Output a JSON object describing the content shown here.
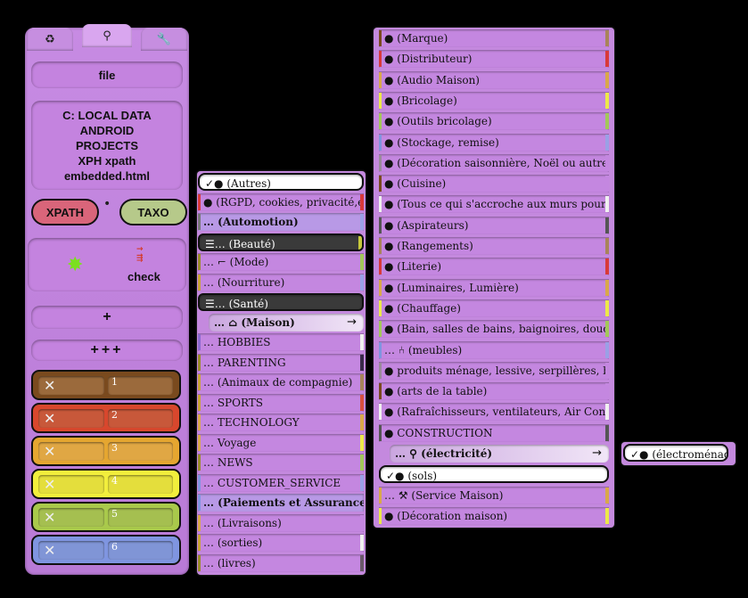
{
  "left": {
    "tabs": [
      {
        "icon": "recycle-icon",
        "glyph": "♻"
      },
      {
        "icon": "search-icon",
        "glyph": "⚲"
      },
      {
        "icon": "wrench-icon",
        "glyph": "🔧"
      }
    ],
    "file_label": "file",
    "path_lines": [
      "C: LOCAL DATA",
      "ANDROID",
      "PROJECTS",
      "XPH xpath",
      "embedded.html"
    ],
    "xpath_label": "XPATH",
    "dot": "•",
    "taxo_label": "TAXO",
    "check_label": "check",
    "plus_label": "+",
    "plus3_label": "+++",
    "colors": [
      {
        "bg": "#7a4a1e",
        "chip": "#9b6a3c",
        "num": "1"
      },
      {
        "bg": "#d8472d",
        "chip": "#c8583a",
        "num": "2"
      },
      {
        "bg": "#e5a630",
        "chip": "#e0a744",
        "num": "3"
      },
      {
        "bg": "#f2ee3c",
        "chip": "#e4de3c",
        "num": "4"
      },
      {
        "bg": "#a9c94b",
        "chip": "#a5bf50",
        "num": "5"
      },
      {
        "bg": "#7f95e0",
        "chip": "#8095d6",
        "num": "6"
      }
    ]
  },
  "list1": [
    {
      "text": "✓● (Autres)",
      "style": "white"
    },
    {
      "text": "● (RGPD, cookies, privacité,etc)",
      "lb": "#d83a3a",
      "rb": "#d83a3a"
    },
    {
      "text": "… (Automotion)",
      "lb": "#777",
      "rb": "#9aa0e6",
      "bold": true,
      "bg": "#b899e6"
    },
    {
      "text": "☰… (Beauté)",
      "style": "dark",
      "rb": "#c7c83c"
    },
    {
      "text": "… ⌐ (Mode)",
      "lb": "#9a8b2a",
      "rb": "#a3c75a"
    },
    {
      "text": "… (Nourriture)",
      "lb": "#c7a335",
      "rb": "#9aa0e6"
    },
    {
      "text": "☰… (Santé)",
      "style": "dark"
    },
    {
      "text": "… ⌂ (Maison)",
      "style": "light",
      "arrow": "→",
      "bold": true,
      "indent": true
    },
    {
      "text": "… HOBBIES",
      "lb": "#8a6ad0",
      "rb": "#f0f0f0"
    },
    {
      "text": "… PARENTING",
      "lb": "#9a8b2a",
      "rb": "#3a2a4a"
    },
    {
      "text": "… (Animaux de compagnie)",
      "lb": "#c7a335",
      "rb": "#a8845a"
    },
    {
      "text": "… SPORTS",
      "lb": "#c7a335",
      "rb": "#d85040"
    },
    {
      "text": "… TECHNOLOGY",
      "lb": "#d8a84a",
      "rb": "#d8a84a"
    },
    {
      "text": "… Voyage",
      "lb": "#d8a84a",
      "rb": "#ece84a"
    },
    {
      "text": "… NEWS",
      "lb": "#9a8b2a",
      "rb": "#a3c75a"
    },
    {
      "text": "… CUSTOMER_SERVICE",
      "lb": "#7f95e0",
      "rb": "#9aa0e6"
    },
    {
      "text": "… (Paiements et Assurances)",
      "lb": "#7f95e0",
      "bold": true,
      "bg": "#b899e6"
    },
    {
      "text": "… (Livraisons)",
      "lb": "#d8a84a",
      "rb": "#c487e0"
    },
    {
      "text": "… (sorties)",
      "lb": "#c7a335",
      "rb": "#f0f0f0"
    },
    {
      "text": "… (livres)",
      "lb": "#9a8b2a",
      "rb": "#6a5a6a"
    }
  ],
  "list2": [
    {
      "text": "● (Marque)",
      "lb": "#7a4a1e",
      "rb": "#a8845a"
    },
    {
      "text": "● (Distributeur)",
      "lb": "#d83a3a",
      "rb": "#d83a3a"
    },
    {
      "text": "● (Audio Maison)",
      "lb": "#d8a84a",
      "rb": "#d8a84a"
    },
    {
      "text": "● (Bricolage)",
      "lb": "#ece84a",
      "rb": "#ece84a"
    },
    {
      "text": "● (Outils bricolage)",
      "lb": "#a3c75a",
      "rb": "#a3c75a"
    },
    {
      "text": "● (Stockage, remise)",
      "lb": "#7f95e0",
      "rb": "#9aa0e6"
    },
    {
      "text": "● (Décoration saisonnière, Noël ou autres fêtes)",
      "lb": "#9a8b9a",
      "rb": "#c487e0"
    },
    {
      "text": "● (Cuisine)",
      "lb": "#7a4a1e",
      "rb": "#c487e0"
    },
    {
      "text": "● (Tous ce qui s'accroche aux murs pour décorer)",
      "lb": "#f0f0f0",
      "rb": "#f0f0f0"
    },
    {
      "text": "● (Aspirateurs)",
      "lb": "#555",
      "rb": "#555"
    },
    {
      "text": "● (Rangements)",
      "lb": "#a8845a",
      "rb": "#a8845a"
    },
    {
      "text": "● (Literie)",
      "lb": "#d83a3a",
      "rb": "#d83a3a"
    },
    {
      "text": "● (Luminaires, Lumière)",
      "lb": "#d8a84a",
      "rb": "#d8a84a"
    },
    {
      "text": "● (Chauffage)",
      "lb": "#ece84a",
      "rb": "#ece84a"
    },
    {
      "text": "● (Bain, salles de bains, baignoires, douches, …",
      "lb": "#a3c75a",
      "rb": "#a3c75a"
    },
    {
      "text": "… ⑃ (meubles)",
      "lb": "#7f95e0",
      "rb": "#9aa0e6"
    },
    {
      "text": "● produits ménage, lessive, serpillères, balais…",
      "lb": "#9a8b9a",
      "rb": "#c487e0"
    },
    {
      "text": "● (arts de la table)",
      "lb": "#7a4a1e",
      "rb": "#c487e0"
    },
    {
      "text": "● (Rafraîchisseurs, ventilateurs, Air Condition…",
      "lb": "#f0f0f0",
      "rb": "#f0f0f0"
    },
    {
      "text": "● CONSTRUCTION",
      "lb": "#555",
      "rb": "#555"
    },
    {
      "text": "… ⚲ (électricité)",
      "style": "light",
      "arrow": "→",
      "bold": true,
      "indent": true
    },
    {
      "text": "✓● (sols)",
      "style": "white"
    },
    {
      "text": "… ⚒ (Service Maison)",
      "lb": "#d8a84a",
      "rb": "#d8a84a"
    },
    {
      "text": "● (Décoration maison)",
      "lb": "#ece84a",
      "rb": "#ece84a"
    }
  ],
  "list3": [
    {
      "text": "✓● (électroménager)",
      "style": "white"
    }
  ]
}
